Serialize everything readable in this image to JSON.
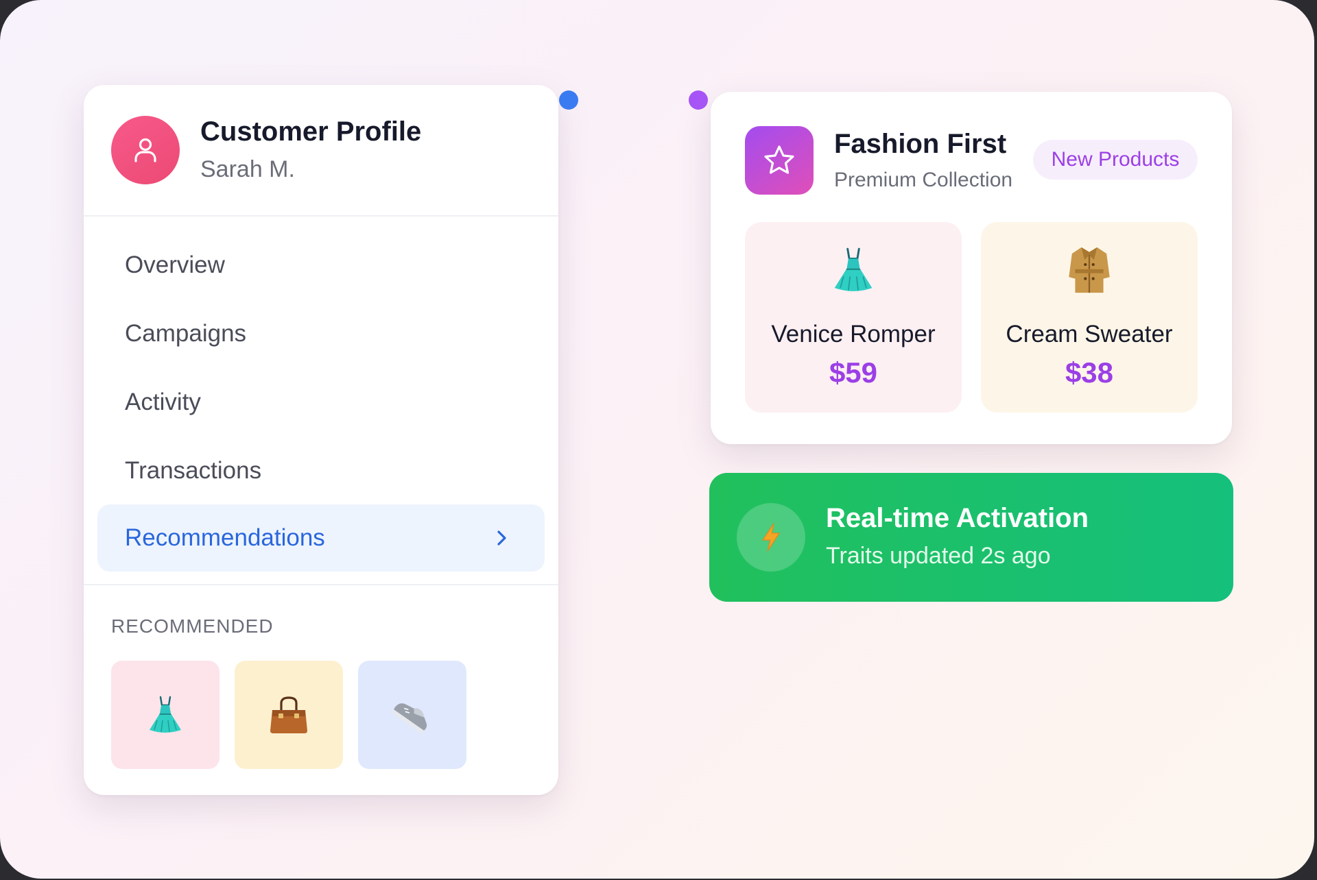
{
  "profile": {
    "title": "Customer Profile",
    "name": "Sarah M.",
    "nav": [
      {
        "label": "Overview"
      },
      {
        "label": "Campaigns"
      },
      {
        "label": "Activity"
      },
      {
        "label": "Transactions"
      },
      {
        "label": "Recommendations",
        "active": true
      }
    ],
    "recommended_label": "RECOMMENDED",
    "recommended_items": [
      {
        "icon": "dress-icon",
        "tile_color": "#fde4ea"
      },
      {
        "icon": "handbag-icon",
        "tile_color": "#fdf0cf"
      },
      {
        "icon": "sneaker-icon",
        "tile_color": "#dfe8fd"
      }
    ]
  },
  "fashion": {
    "brand": "Fashion First",
    "subtitle": "Premium Collection",
    "badge": "New Products",
    "products": [
      {
        "name": "Venice Romper",
        "price": "$59",
        "icon": "dress-icon",
        "tile_color": "#fdf0f2"
      },
      {
        "name": "Cream Sweater",
        "price": "$38",
        "icon": "trench-coat-icon",
        "tile_color": "#fdf6e8"
      }
    ]
  },
  "activation": {
    "title": "Real-time Activation",
    "subtitle": "Traits updated 2s ago",
    "icon": "lightning-icon"
  },
  "colors": {
    "accent_blue": "#2a66dc",
    "accent_purple": "#9b3fe6",
    "success_green": "#1fc06a",
    "avatar_pink": "#f0507c"
  }
}
